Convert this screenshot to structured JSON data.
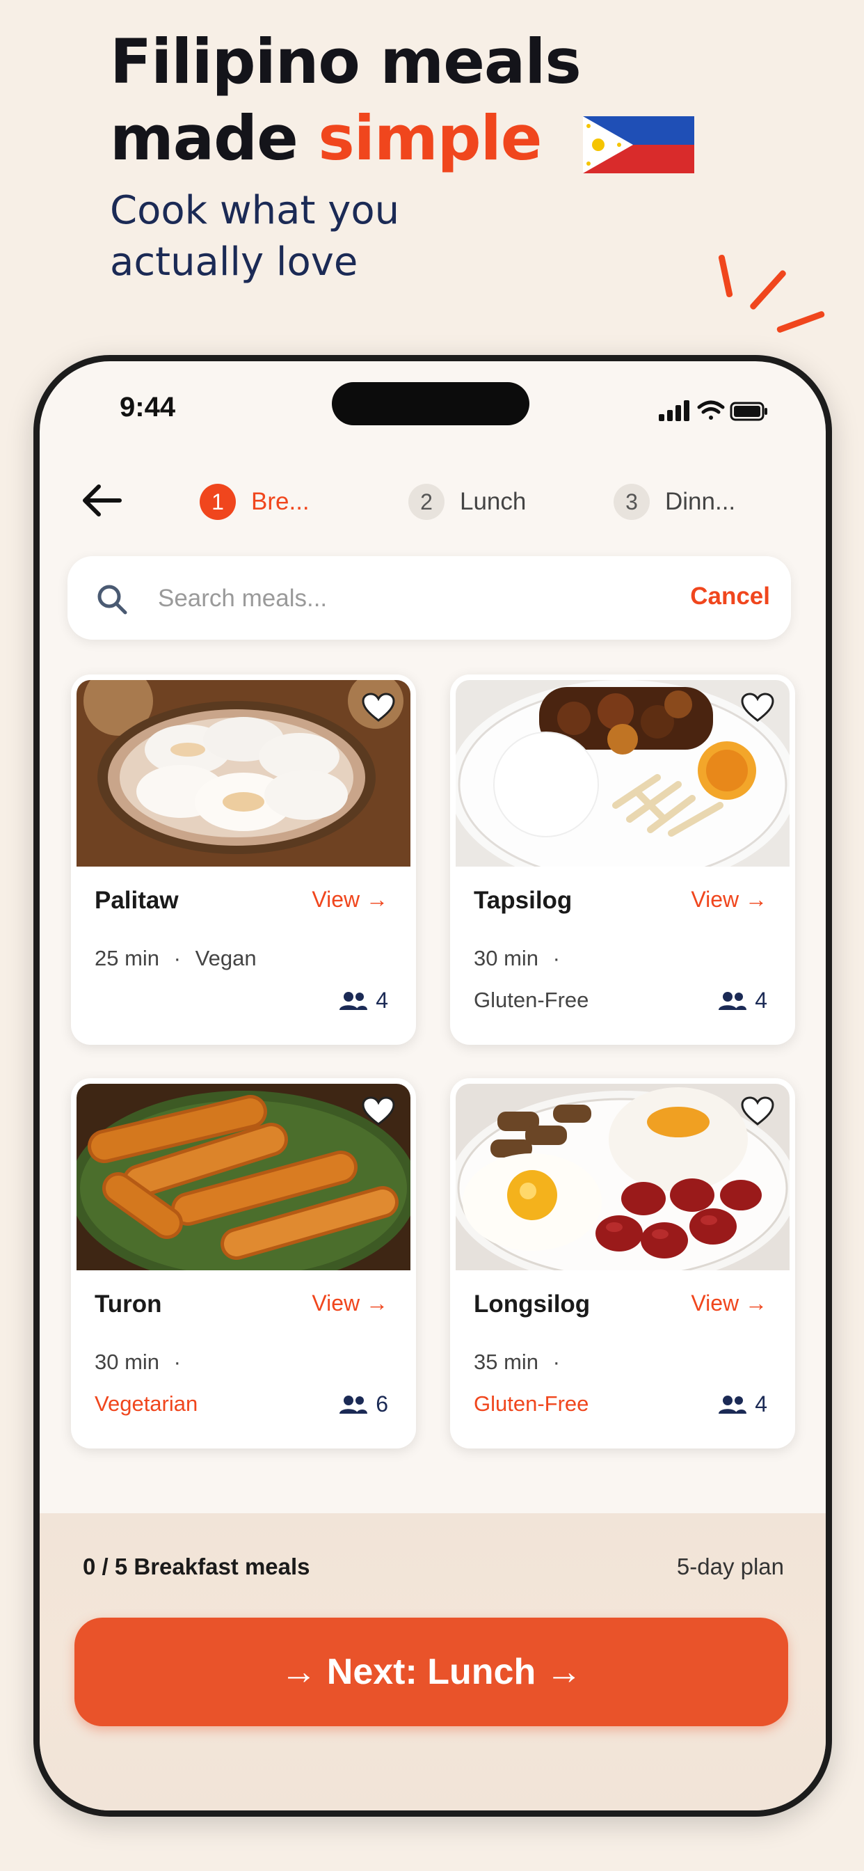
{
  "headline": {
    "line1": "Filipino meals",
    "line2_prefix": "made",
    "line2_accent": "simple",
    "flag_icon": "philippines-flag-icon"
  },
  "subhead": {
    "line1": "Cook what you",
    "line2": "actually love"
  },
  "status_bar": {
    "time": "9:44"
  },
  "steps": [
    {
      "number": "1",
      "label": "Bre...",
      "active": true
    },
    {
      "number": "2",
      "label": "Lunch",
      "active": false
    },
    {
      "number": "3",
      "label": "Dinn...",
      "active": false
    }
  ],
  "search": {
    "placeholder": "Search meals...",
    "cancel_label": "Cancel"
  },
  "meals": [
    {
      "name": "Palitaw",
      "view_label": "View →",
      "time": "25 min",
      "separator": "·",
      "tag": "Vegan",
      "servings": "4"
    },
    {
      "name": "Tapsilog",
      "view_label": "View →",
      "time": "30 min",
      "separator": "·",
      "tag": "Gluten-Free",
      "servings": "4"
    },
    {
      "name": "Turon",
      "view_label": "View →",
      "time": "30 min",
      "separator": "·",
      "tag": "Vegetarian",
      "servings": "6"
    },
    {
      "name": "Longsilog",
      "view_label": "View →",
      "time": "35 min",
      "separator": "·",
      "tag": "Gluten-Free",
      "servings": "4"
    }
  ],
  "footer": {
    "progress": "0 / 5 Breakfast meals",
    "plan": "5-day plan",
    "next_button": "→ Next: Lunch →"
  },
  "colors": {
    "accent": "#f0461d",
    "navy": "#1b2a55",
    "background": "#f7efe6"
  }
}
